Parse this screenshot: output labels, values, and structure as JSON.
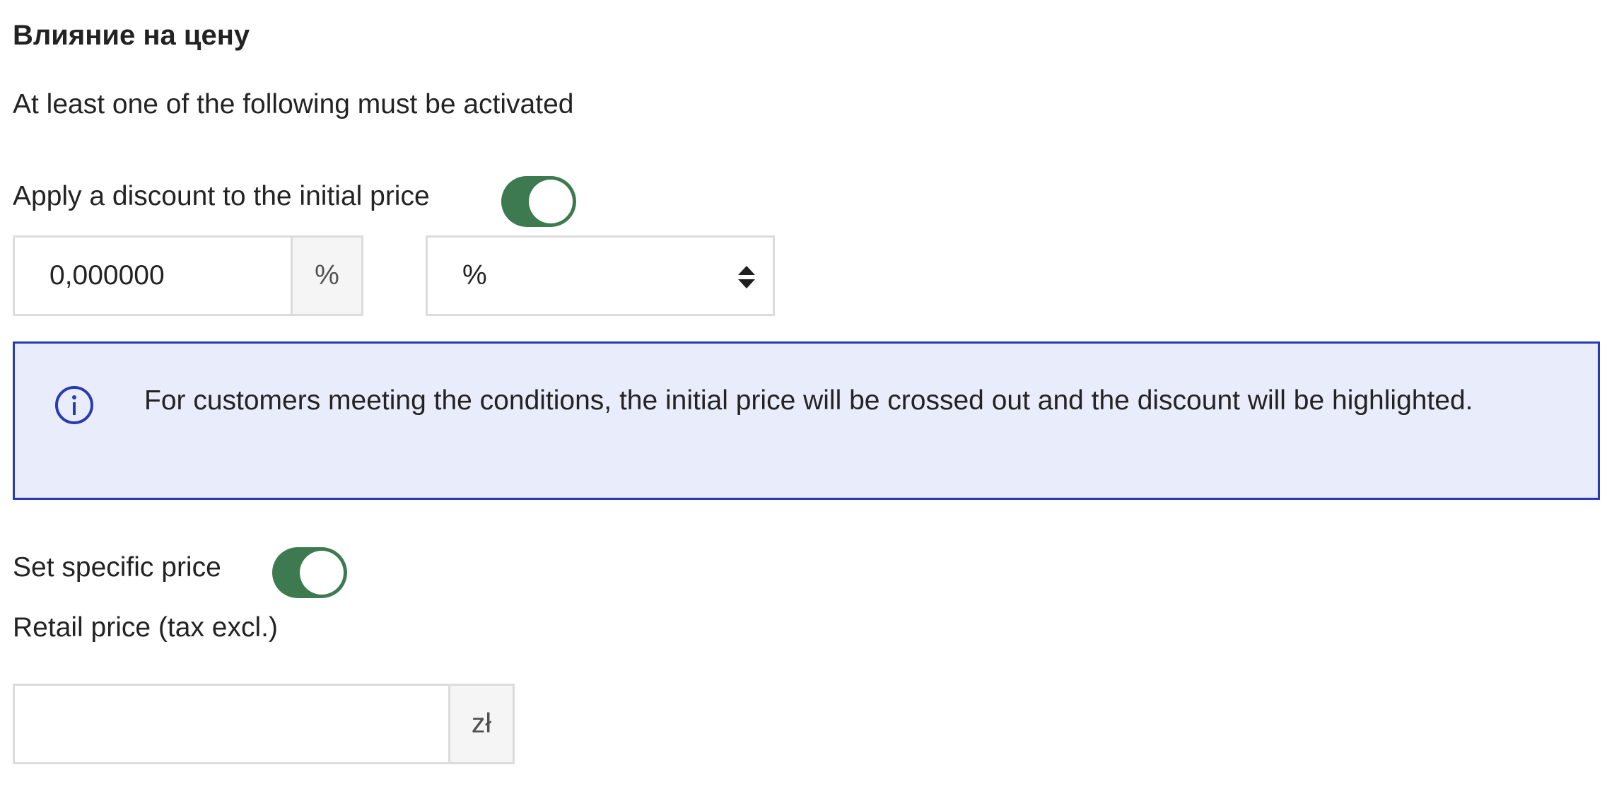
{
  "section": {
    "title": "Влияние на цену",
    "subtitle": "At least one of the following must be activated"
  },
  "discount": {
    "toggle_label": "Apply a discount to the initial price",
    "toggle_on": true,
    "value": "0,000000",
    "unit_addon": "%",
    "type_select": {
      "selected": "%",
      "icon": "sort-arrows-icon"
    }
  },
  "info_alert": {
    "icon": "info-circle-icon",
    "text": "For customers meeting the conditions, the initial price will be crossed out and the discount will be highlighted."
  },
  "specific_price": {
    "toggle_label": "Set specific price",
    "toggle_on": true,
    "retail_label": "Retail price (tax excl.)",
    "retail_value": "",
    "currency_addon": "zł"
  },
  "colors": {
    "toggle_on": "#3d7a4f",
    "alert_background": "#e9edfb",
    "alert_border": "#2a3ab3",
    "info_icon": "#2a3ab3"
  }
}
